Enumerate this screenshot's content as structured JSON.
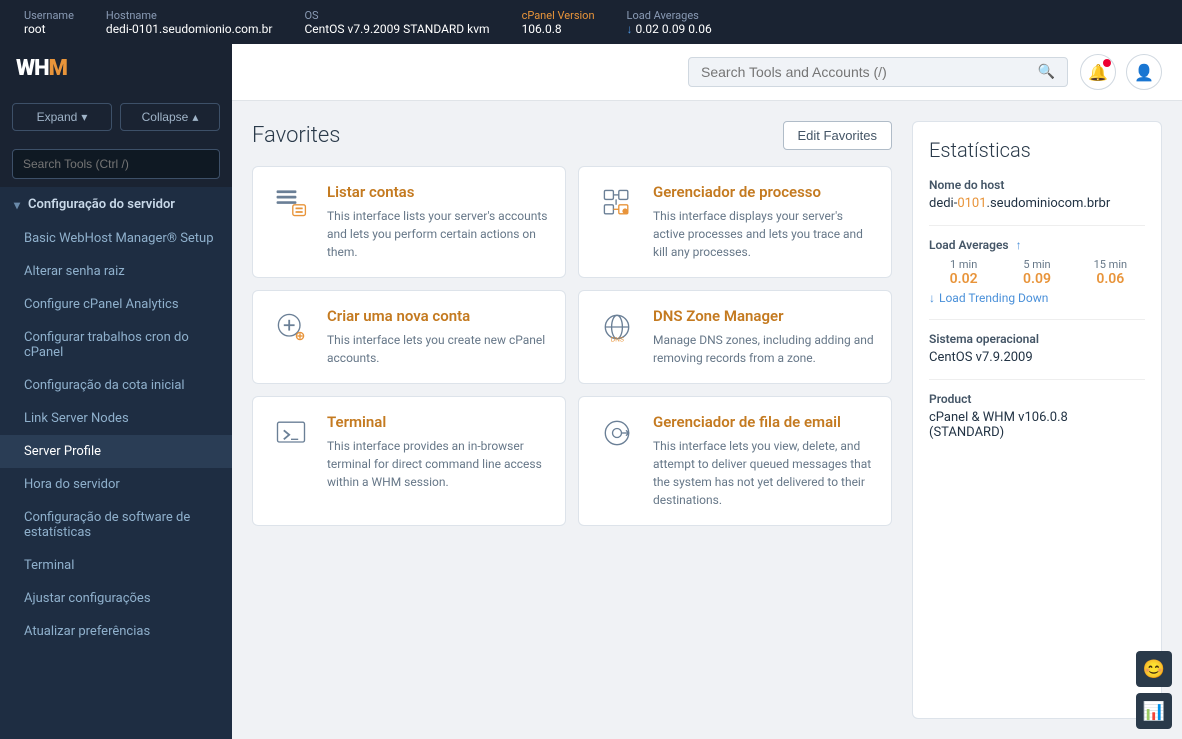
{
  "topbar": {
    "username_label": "Username",
    "username_value": "root",
    "hostname_label": "Hostname",
    "hostname_value": "dedi-0101.seudomionio.com.br",
    "os_label": "OS",
    "os_value": "CentOS v7.9.2009 STANDARD kvm",
    "cpanel_label": "cPanel Version",
    "cpanel_value": "106.0.8",
    "load_label": "Load Averages",
    "load_down": "↓",
    "load_1": "0.02",
    "load_5": "0.09",
    "load_15": "0.06"
  },
  "sidebar": {
    "logo": "WHM",
    "expand_label": "Expand",
    "collapse_label": "Collapse",
    "search_placeholder": "Search Tools (Ctrl /)",
    "section_label": "Configuração do servidor",
    "items": [
      {
        "label": "Basic WebHost Manager® Setup"
      },
      {
        "label": "Alterar senha raiz"
      },
      {
        "label": "Configure cPanel Analytics"
      },
      {
        "label": "Configurar trabalhos cron do cPanel"
      },
      {
        "label": "Configuração da cota inicial"
      },
      {
        "label": "Link Server Nodes"
      },
      {
        "label": "Server Profile",
        "active": true
      },
      {
        "label": "Hora do servidor"
      },
      {
        "label": "Configuração de software de estatísticas"
      },
      {
        "label": "Terminal"
      },
      {
        "label": "Ajustar configurações"
      },
      {
        "label": "Atualizar preferências"
      }
    ]
  },
  "header": {
    "search_placeholder": "Search Tools and Accounts (/)"
  },
  "favorites": {
    "title": "Favorites",
    "edit_label": "Edit Favorites",
    "cards": [
      {
        "title": "Listar contas",
        "desc": "This interface lists your server's accounts and lets you perform certain actions on them.",
        "icon": "list"
      },
      {
        "title": "Gerenciador de processo",
        "desc": "This interface displays your server's active processes and lets you trace and kill any processes.",
        "icon": "process"
      },
      {
        "title": "Criar uma nova conta",
        "desc": "This interface lets you create new cPanel accounts.",
        "icon": "add-account"
      },
      {
        "title": "DNS Zone Manager",
        "desc": "Manage DNS zones, including adding and removing records from a zone.",
        "icon": "dns"
      },
      {
        "title": "Terminal",
        "desc": "This interface provides an in-browser terminal for direct command line access within a WHM session.",
        "icon": "terminal"
      },
      {
        "title": "Gerenciador de fila de email",
        "desc": "This interface lets you view, delete, and attempt to deliver queued messages that the system has not yet delivered to their destinations.",
        "icon": "email"
      }
    ]
  },
  "stats": {
    "title": "Estatísticas",
    "hostname_label": "Nome do host",
    "hostname_value": "dedi-0101.seudominiocom.brbr",
    "hostname_highlight": "0101",
    "load_label": "Load Averages",
    "load_1_label": "1 min",
    "load_5_label": "5 min",
    "load_15_label": "15 min",
    "load_1": "0.02",
    "load_5": "0.09",
    "load_15": "0.06",
    "load_trend": "↓ Load Trending Down",
    "os_label": "Sistema operacional",
    "os_value": "CentOS v7.9.2009",
    "product_label": "Product",
    "product_value": "cPanel & WHM v106.0.8 (STANDARD)"
  }
}
